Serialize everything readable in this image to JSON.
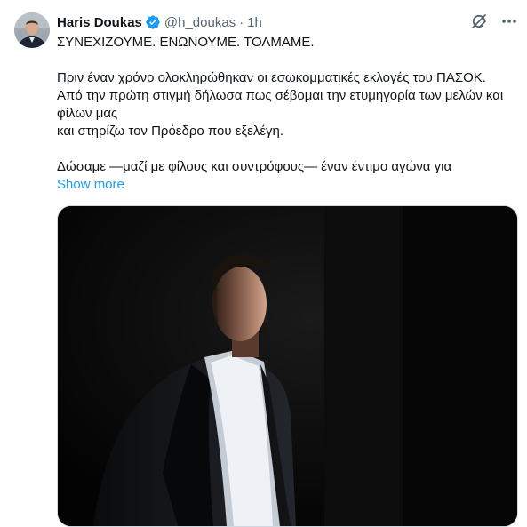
{
  "author": {
    "name": "Haris Doukas",
    "handle": "@h_doukas",
    "separator": "·",
    "time": "1h"
  },
  "tweet": {
    "lines": [
      "ΣΥΝΕΧΙΖΟΥΜΕ. ΕΝΩΝΟΥΜΕ. ΤΟΛΜΑΜΕ.",
      "",
      "Πριν έναν χρόνο ολοκληρώθηκαν οι εσωκομματικές εκλογές του ΠΑΣΟΚ.",
      "Από την πρώτη στιγμή δήλωσα πως σέβομαι την ετυμηγορία των μελών και φίλων μας",
      "και στηρίζω τον Πρόεδρο που εξελέγη.",
      "",
      "Δώσαμε —μαζί με φίλους και συντρόφους— έναν έντιμο αγώνα για"
    ],
    "show_more_label": "Show more"
  },
  "icons": {
    "verified": "verified-badge-icon",
    "grok": "grok-icon",
    "more": "more-icon"
  },
  "colors": {
    "accent": "#1d9bf0",
    "secondary_text": "#536471",
    "primary_text": "#0f1419"
  }
}
